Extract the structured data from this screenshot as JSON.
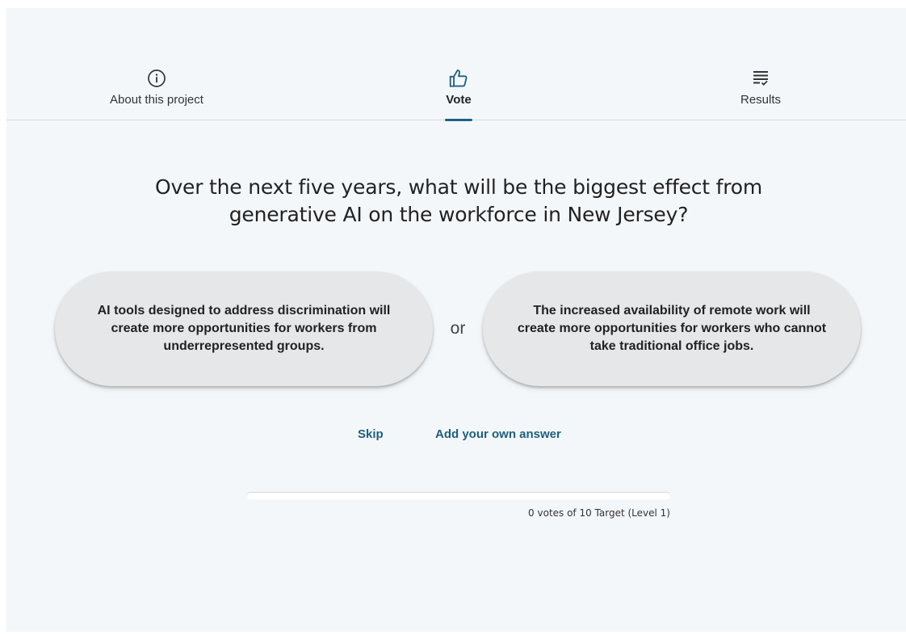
{
  "tabs": [
    {
      "label": "About this project",
      "icon": "info-icon",
      "active": false
    },
    {
      "label": "Vote",
      "icon": "thumbs-up-icon",
      "active": true
    },
    {
      "label": "Results",
      "icon": "results-list-icon",
      "active": false
    }
  ],
  "question": "Over the next five years, what will be the biggest effect from generative AI on the workforce in New Jersey?",
  "choices": [
    {
      "text": "AI tools designed to address discrimination will create more opportunities for workers from underrepresented groups."
    },
    {
      "text": "The increased availability of remote work will create more opportunities for workers who cannot take traditional office jobs."
    }
  ],
  "or_label": "or",
  "actions": {
    "skip": "Skip",
    "add_answer": "Add your own answer"
  },
  "progress": {
    "fraction": 0,
    "caption": "0 votes of 10 Target (Level 1)"
  },
  "colors": {
    "accent": "#1d6282",
    "background": "#f4f7fa",
    "choice_bg": "#e6e7e9"
  }
}
